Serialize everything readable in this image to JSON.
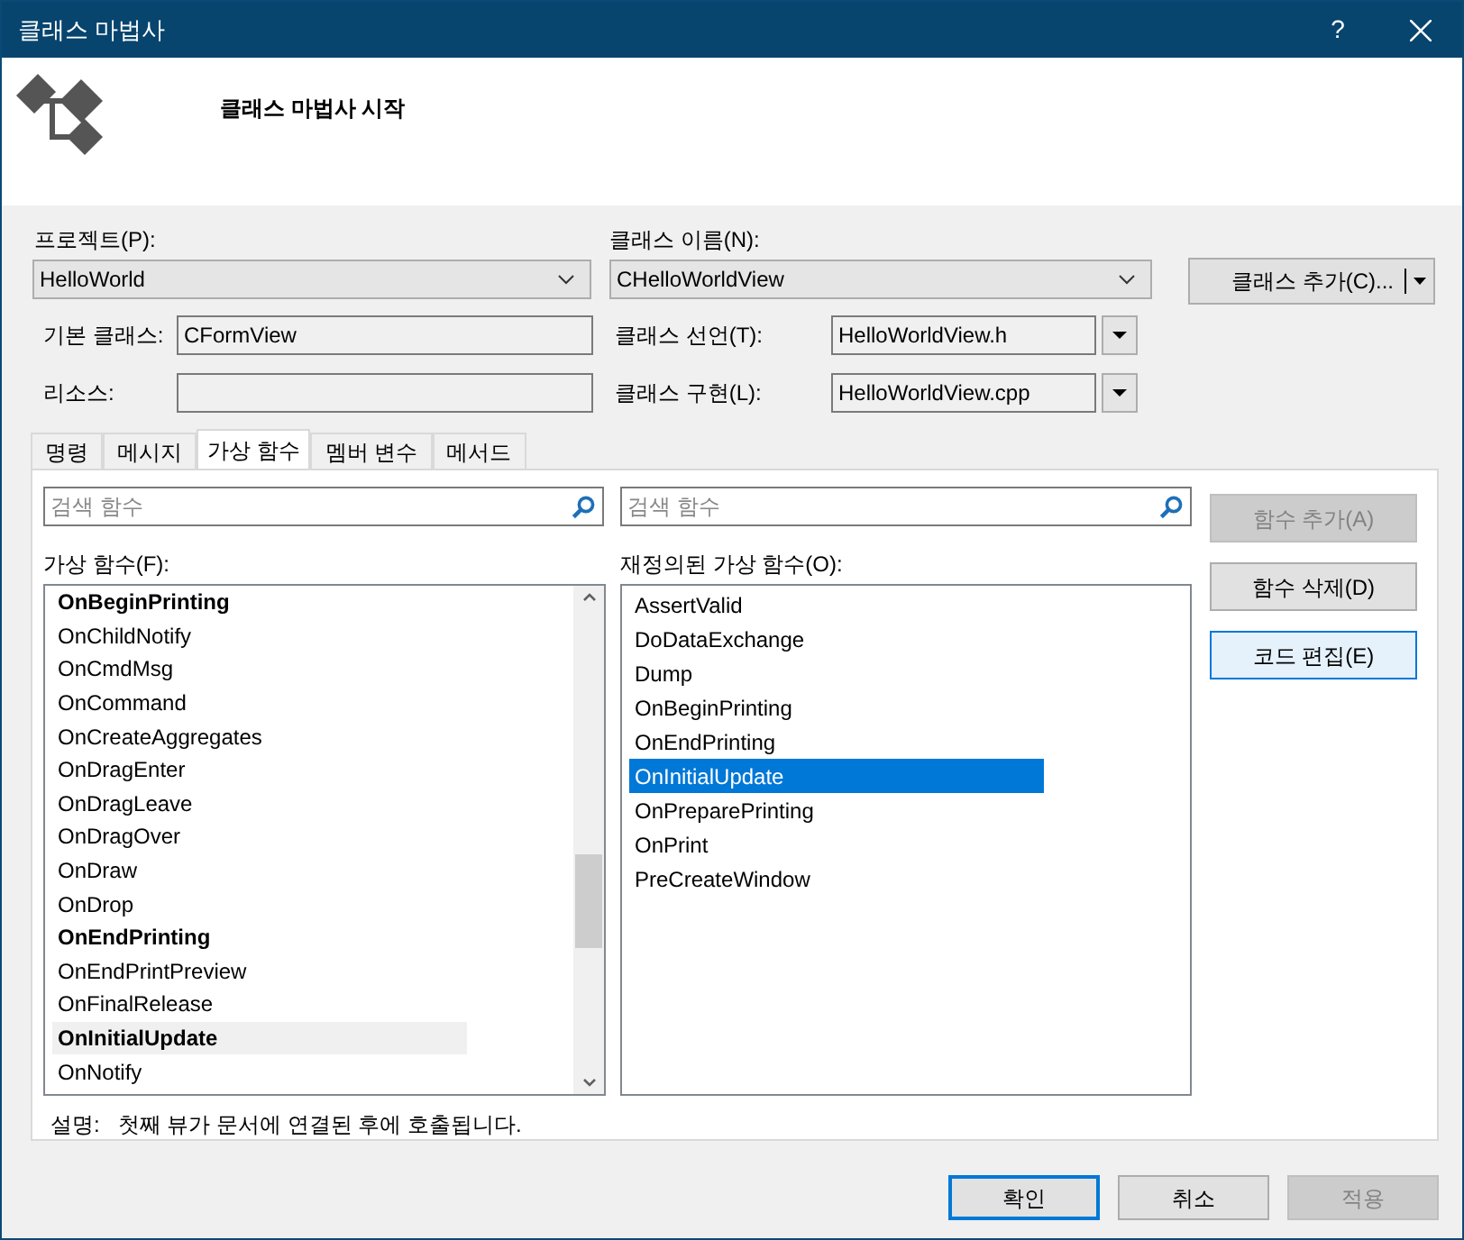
{
  "window": {
    "title": "클래스 마법사",
    "help": "?"
  },
  "header": {
    "title": "클래스 마법사 시작"
  },
  "project": {
    "label": "프로젝트(P):",
    "value": "HelloWorld"
  },
  "class_name": {
    "label": "클래스 이름(N):",
    "value": "CHelloWorldView"
  },
  "add_class_button": {
    "label": "클래스 추가(C)..."
  },
  "base_class": {
    "label": "기본 클래스:",
    "value": "CFormView"
  },
  "resource": {
    "label": "리소스:"
  },
  "declaration": {
    "label": "클래스 선언(T):",
    "value": "HelloWorldView.h"
  },
  "implementation": {
    "label": "클래스 구현(L):",
    "value": "HelloWorldView.cpp"
  },
  "tabs": [
    {
      "label": "명령",
      "selected": false
    },
    {
      "label": "메시지",
      "selected": false
    },
    {
      "label": "가상 함수",
      "selected": true
    },
    {
      "label": "멤버 변수",
      "selected": false
    },
    {
      "label": "메서드",
      "selected": false
    }
  ],
  "search_left": {
    "placeholder": "검색 함수"
  },
  "search_right": {
    "placeholder": "검색 함수"
  },
  "virtual_functions": {
    "label": "가상 함수(F):",
    "items": [
      {
        "label": "OnBeginPrinting",
        "bold": true,
        "selected": false
      },
      {
        "label": "OnChildNotify",
        "bold": false,
        "selected": false
      },
      {
        "label": "OnCmdMsg",
        "bold": false,
        "selected": false
      },
      {
        "label": "OnCommand",
        "bold": false,
        "selected": false
      },
      {
        "label": "OnCreateAggregates",
        "bold": false,
        "selected": false
      },
      {
        "label": "OnDragEnter",
        "bold": false,
        "selected": false
      },
      {
        "label": "OnDragLeave",
        "bold": false,
        "selected": false
      },
      {
        "label": "OnDragOver",
        "bold": false,
        "selected": false
      },
      {
        "label": "OnDraw",
        "bold": false,
        "selected": false
      },
      {
        "label": "OnDrop",
        "bold": false,
        "selected": false
      },
      {
        "label": "OnEndPrinting",
        "bold": true,
        "selected": false
      },
      {
        "label": "OnEndPrintPreview",
        "bold": false,
        "selected": false
      },
      {
        "label": "OnFinalRelease",
        "bold": false,
        "selected": false
      },
      {
        "label": "OnInitialUpdate",
        "bold": true,
        "selected": true
      },
      {
        "label": "OnNotify",
        "bold": false,
        "selected": false
      }
    ]
  },
  "overridden_functions": {
    "label": "재정의된 가상 함수(O):",
    "items": [
      {
        "label": "AssertValid",
        "selected": false
      },
      {
        "label": "DoDataExchange",
        "selected": false
      },
      {
        "label": "Dump",
        "selected": false
      },
      {
        "label": "OnBeginPrinting",
        "selected": false
      },
      {
        "label": "OnEndPrinting",
        "selected": false
      },
      {
        "label": "OnInitialUpdate",
        "selected": true
      },
      {
        "label": "OnPreparePrinting",
        "selected": false
      },
      {
        "label": "OnPrint",
        "selected": false
      },
      {
        "label": "PreCreateWindow",
        "selected": false
      }
    ]
  },
  "side_buttons": [
    {
      "label": "함수 추가(A)",
      "disabled": true,
      "focused": false
    },
    {
      "label": "함수 삭제(D)",
      "disabled": false,
      "focused": false
    },
    {
      "label": "코드 편집(E)",
      "disabled": false,
      "focused": true
    }
  ],
  "description": {
    "label": "설명:",
    "text": "첫째 뷰가 문서에 연결된 후에 호출됩니다."
  },
  "footer_buttons": [
    {
      "label": "확인",
      "disabled": false,
      "default": true
    },
    {
      "label": "취소",
      "disabled": false,
      "default": false
    },
    {
      "label": "적용",
      "disabled": true,
      "default": false
    }
  ]
}
